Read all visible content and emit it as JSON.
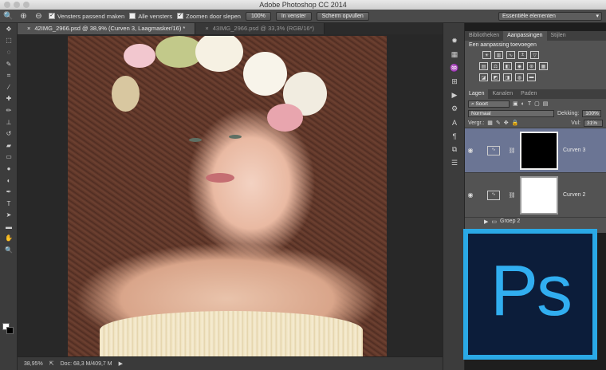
{
  "window": {
    "title": "Adobe Photoshop CC 2014"
  },
  "options_bar": {
    "tool_icon": "zoom-icon",
    "zoom_in_icon": "zoom-in-icon",
    "zoom_out_icon": "zoom-out-icon",
    "checkbox_resize": "Vensters passend maken",
    "checkbox_all": "Alle vensters",
    "checkbox_scrubby": "Zoomen door slepen",
    "btn_100": "100%",
    "btn_fit": "In venster",
    "btn_fill": "Scherm opvullen",
    "workspace": "Essentiële elementen",
    "checked_resize": true,
    "checked_all": false,
    "checked_scrubby": true
  },
  "document_tabs": [
    {
      "label": "42IMG_2966.psd @ 38,9% (Curven 3, Laagmasker/16) *",
      "active": true
    },
    {
      "label": "43IMG_2966.psd @ 33,3% (RGB/16*)",
      "active": false
    }
  ],
  "status_bar": {
    "zoom": "38,95%",
    "doc": "Doc: 68,3 M/409,7 M"
  },
  "panels": {
    "top_tabs": [
      "Bibliotheken",
      "Aanpassingen",
      "Stijlen"
    ],
    "adjustments_title": "Een aanpassing toevoegen",
    "layers_tabs": [
      "Lagen",
      "Kanalen",
      "Paden"
    ],
    "filter_kind": "Soort",
    "blend_mode": "Normaal",
    "opacity_label": "Dekking:",
    "opacity_value": "100%",
    "lock_label": "Vergr.:",
    "fill_label": "Vul:",
    "fill_value": "31%",
    "layers": [
      {
        "name": "Curven 3",
        "mask": "black",
        "selected": true
      },
      {
        "name": "Curven 2",
        "mask": "white",
        "selected": false
      }
    ],
    "group_name": "Groep 2"
  },
  "logo": {
    "text": "Ps",
    "accent": "#2aa9e6"
  }
}
